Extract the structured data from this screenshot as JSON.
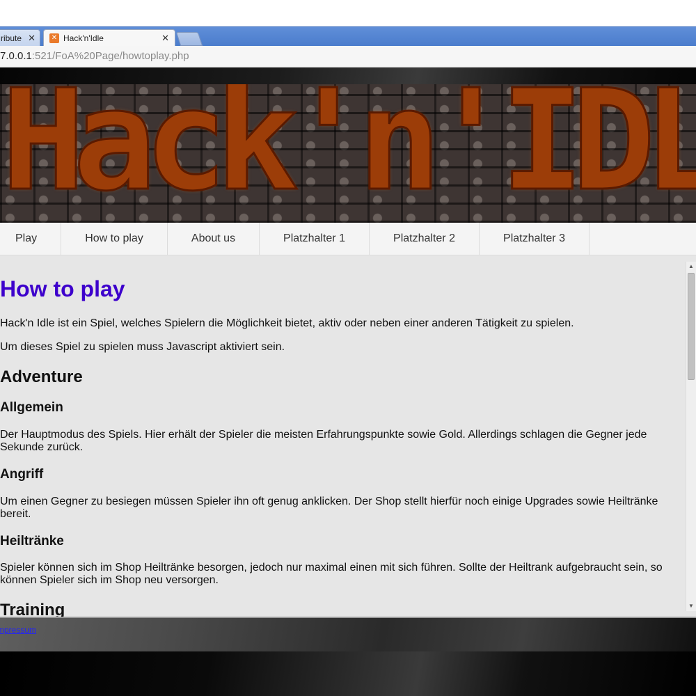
{
  "browser": {
    "tabs": [
      {
        "label": "ribute",
        "active": false
      },
      {
        "label": "Hack'n'Idle",
        "active": true
      }
    ],
    "url_host": "7.0.0.1",
    "url_path": ":521/FoA%20Page/howtoplay.php"
  },
  "banner": {
    "logo_text": "Hack'n'IDLE"
  },
  "nav": {
    "items": [
      "Play",
      "How to play",
      "About us",
      "Platzhalter 1",
      "Platzhalter 2",
      "Platzhalter 3"
    ]
  },
  "content": {
    "title": "How to play",
    "intro1": "Hack'n Idle ist ein Spiel, welches Spielern die Möglichkeit bietet, aktiv oder neben einer anderen Tätigkeit zu spielen.",
    "intro2": "Um dieses Spiel zu spielen muss Javascript aktiviert sein.",
    "section_adventure": "Adventure",
    "sub_allgemein": "Allgemein",
    "text_allgemein": "Der Hauptmodus des Spiels. Hier erhält der Spieler die meisten Erfahrungspunkte sowie Gold. Allerdings schlagen die Gegner jede Sekunde zurück.",
    "sub_angriff": "Angriff",
    "text_angriff": "Um einen Gegner zu besiegen müssen Spieler ihn oft genug anklicken. Der Shop stellt hierfür noch einige Upgrades sowie Heiltränke bereit.",
    "sub_heiltraenke": "Heiltränke",
    "text_heiltraenke": "Spieler können sich im Shop Heiltränke besorgen, jedoch nur maximal einen mit sich führen. Sollte der Heiltrank aufgebraucht sein, so können Spieler sich im Shop neu versorgen.",
    "section_training": "Training"
  },
  "footer": {
    "link": "mpressum"
  },
  "colors": {
    "heading_blue": "#3d00cc",
    "link_blue": "#2020ff",
    "logo_orange": "#9c3d08"
  }
}
